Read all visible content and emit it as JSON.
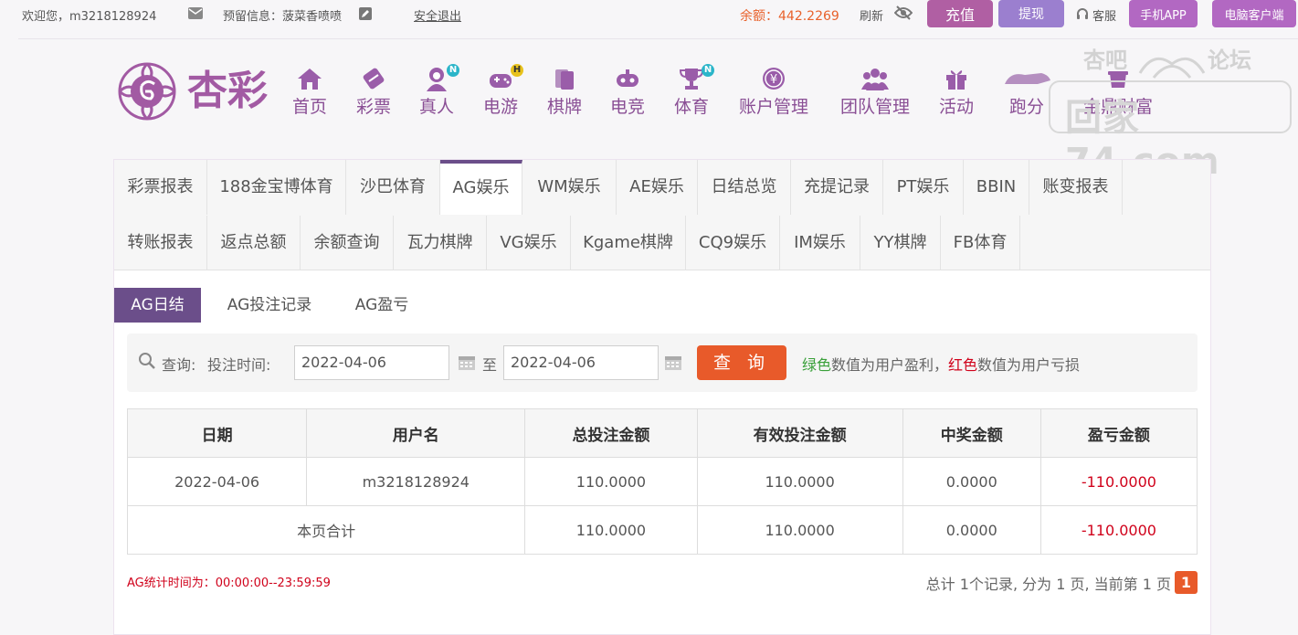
{
  "topbar": {
    "welcome": "欢迎您，m3218128924",
    "reserved_label": "预留信息：菠菜香喷喷",
    "logout": "安全退出",
    "balance_label": "余额：",
    "balance_value": "442.2269",
    "refresh": "刷新",
    "recharge": "充值",
    "withdraw": "提现",
    "service": "客服",
    "mobile_app": "手机APP",
    "pc_client": "电脑客户端",
    "colors": {
      "recharge": "#b05fa3",
      "withdraw": "#9b7fcf",
      "app": "#b268c2",
      "balance": "#e8622c"
    }
  },
  "logo": {
    "text": "杏彩"
  },
  "nav": [
    {
      "label": "首页",
      "icon": "home-icon"
    },
    {
      "label": "彩票",
      "icon": "lottery-icon"
    },
    {
      "label": "真人",
      "icon": "live-dealer-icon",
      "badge": "N"
    },
    {
      "label": "电游",
      "icon": "gamepad-icon",
      "badge": "H"
    },
    {
      "label": "棋牌",
      "icon": "cards-icon"
    },
    {
      "label": "电竞",
      "icon": "esports-icon"
    },
    {
      "label": "体育",
      "icon": "trophy-icon",
      "badge": "N"
    },
    {
      "label": "账户管理",
      "icon": "yen-coin-icon"
    },
    {
      "label": "团队管理",
      "icon": "team-icon"
    },
    {
      "label": "活动",
      "icon": "gift-icon"
    },
    {
      "label": "跑分",
      "icon": "run-icon"
    },
    {
      "label": "金鼎财富",
      "icon": "treasure-icon"
    }
  ],
  "watermark": {
    "top_left": "杏吧",
    "top_right": "论坛",
    "main": "回家74.com"
  },
  "tabs_row1": [
    "彩票报表",
    "188金宝博体育",
    "沙巴体育",
    "AG娱乐",
    "WM娱乐",
    "AE娱乐",
    "日结总览",
    "充提记录",
    "PT娱乐",
    "BBIN",
    "账变报表"
  ],
  "tabs_row2": [
    "转账报表",
    "返点总额",
    "余额查询",
    "瓦力棋牌",
    "VG娱乐",
    "Kgame棋牌",
    "CQ9娱乐",
    "IM娱乐",
    "YY棋牌",
    "FB体育"
  ],
  "active_tab": "AG娱乐",
  "subtabs": [
    "AG日结",
    "AG投注记录",
    "AG盈亏"
  ],
  "query": {
    "label": "查询:",
    "time_label": "投注时间:",
    "start_date": "2022-04-06",
    "to": "至",
    "end_date": "2022-04-06",
    "button": "查 询",
    "hint_green": "绿色",
    "hint_1": "数值为用户盈利，",
    "hint_red": "红色",
    "hint_2": "数值为用户亏损"
  },
  "table": {
    "headers": [
      "日期",
      "用户名",
      "总投注金额",
      "有效投注金额",
      "中奖金额",
      "盈亏金额"
    ],
    "rows": [
      [
        "2022-04-06",
        "m3218128924",
        "110.0000",
        "110.0000",
        "0.0000",
        "-110.0000"
      ]
    ],
    "total": {
      "label": "本页合计",
      "values": [
        "110.0000",
        "110.0000",
        "0.0000",
        "-110.0000"
      ]
    }
  },
  "footer": {
    "stat_note": "AG统计时间为：00:00:00--23:59:59",
    "pager_text": "总计 1个记录, 分为 1 页, 当前第 1 页",
    "current_page": "1"
  }
}
